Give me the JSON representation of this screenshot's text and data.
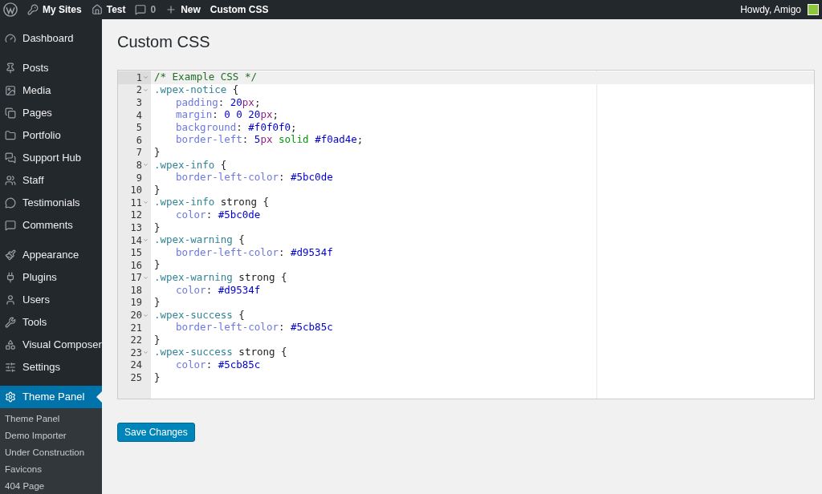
{
  "admin_bar": {
    "items": [
      {
        "label": "My Sites"
      },
      {
        "label": "Test"
      },
      {
        "label": "0"
      },
      {
        "label": "New"
      },
      {
        "label": "Custom CSS"
      }
    ],
    "greeting": "Howdy, Amigo"
  },
  "sidebar": {
    "groups": [
      [
        {
          "label": "Dashboard",
          "selected": false
        }
      ],
      [
        {
          "label": "Posts",
          "selected": false
        },
        {
          "label": "Media",
          "selected": false
        },
        {
          "label": "Pages",
          "selected": false
        },
        {
          "label": "Portfolio",
          "selected": false
        },
        {
          "label": "Support Hub",
          "selected": false
        },
        {
          "label": "Staff",
          "selected": false
        },
        {
          "label": "Testimonials",
          "selected": false
        },
        {
          "label": "Comments",
          "selected": false
        }
      ],
      [
        {
          "label": "Appearance",
          "selected": false
        },
        {
          "label": "Plugins",
          "selected": false
        },
        {
          "label": "Users",
          "selected": false
        },
        {
          "label": "Tools",
          "selected": false
        },
        {
          "label": "Visual Composer",
          "selected": false
        },
        {
          "label": "Settings",
          "selected": false
        }
      ],
      [
        {
          "label": "Theme Panel",
          "selected": true
        }
      ]
    ],
    "submenu": [
      {
        "label": "Theme Panel"
      },
      {
        "label": "Demo Importer"
      },
      {
        "label": "Under Construction"
      },
      {
        "label": "Favicons"
      },
      {
        "label": "404 Page"
      }
    ]
  },
  "page_title": "Custom CSS",
  "editor": {
    "lines": [
      {
        "number": "1",
        "foldable": true,
        "active": true,
        "indented": false,
        "tokens": [
          {
            "kind": "comment",
            "text": "/* Example CSS */"
          }
        ]
      },
      {
        "number": "2",
        "foldable": true,
        "active": false,
        "indented": false,
        "tokens": [
          {
            "kind": "selector",
            "text": ".wpex-notice"
          },
          {
            "kind": "punct",
            "text": " {"
          }
        ]
      },
      {
        "number": "3",
        "foldable": false,
        "active": false,
        "indented": true,
        "tokens": [
          {
            "kind": "property",
            "text": "padding"
          },
          {
            "kind": "punct",
            "text": ": "
          },
          {
            "kind": "number",
            "text": "20"
          },
          {
            "kind": "unit",
            "text": "px"
          },
          {
            "kind": "punct",
            "text": ";"
          }
        ]
      },
      {
        "number": "4",
        "foldable": false,
        "active": false,
        "indented": true,
        "tokens": [
          {
            "kind": "property",
            "text": "margin"
          },
          {
            "kind": "punct",
            "text": ": "
          },
          {
            "kind": "number",
            "text": "0 0 20"
          },
          {
            "kind": "unit",
            "text": "px"
          },
          {
            "kind": "punct",
            "text": ";"
          }
        ]
      },
      {
        "number": "5",
        "foldable": false,
        "active": false,
        "indented": true,
        "tokens": [
          {
            "kind": "property",
            "text": "background"
          },
          {
            "kind": "punct",
            "text": ": "
          },
          {
            "kind": "number",
            "text": "#f0f0f0"
          },
          {
            "kind": "punct",
            "text": ";"
          }
        ]
      },
      {
        "number": "6",
        "foldable": false,
        "active": false,
        "indented": true,
        "tokens": [
          {
            "kind": "property",
            "text": "border-left"
          },
          {
            "kind": "punct",
            "text": ": "
          },
          {
            "kind": "number",
            "text": "5"
          },
          {
            "kind": "unit",
            "text": "px"
          },
          {
            "kind": "constant",
            "text": " solid"
          },
          {
            "kind": "number",
            "text": " #f0ad4e"
          },
          {
            "kind": "punct",
            "text": ";"
          }
        ]
      },
      {
        "number": "7",
        "foldable": false,
        "active": false,
        "indented": false,
        "tokens": [
          {
            "kind": "punct",
            "text": "}"
          }
        ]
      },
      {
        "number": "8",
        "foldable": true,
        "active": false,
        "indented": false,
        "tokens": [
          {
            "kind": "selector",
            "text": ".wpex-info"
          },
          {
            "kind": "punct",
            "text": " {"
          }
        ]
      },
      {
        "number": "9",
        "foldable": false,
        "active": false,
        "indented": true,
        "tokens": [
          {
            "kind": "property",
            "text": "border-left-color"
          },
          {
            "kind": "punct",
            "text": ": "
          },
          {
            "kind": "number",
            "text": "#5bc0de"
          }
        ]
      },
      {
        "number": "10",
        "foldable": false,
        "active": false,
        "indented": false,
        "tokens": [
          {
            "kind": "punct",
            "text": "}"
          }
        ]
      },
      {
        "number": "11",
        "foldable": true,
        "active": false,
        "indented": false,
        "tokens": [
          {
            "kind": "selector",
            "text": ".wpex-info"
          },
          {
            "kind": "punct",
            "text": " strong {"
          }
        ]
      },
      {
        "number": "12",
        "foldable": false,
        "active": false,
        "indented": true,
        "tokens": [
          {
            "kind": "property",
            "text": "color"
          },
          {
            "kind": "punct",
            "text": ": "
          },
          {
            "kind": "number",
            "text": "#5bc0de"
          }
        ]
      },
      {
        "number": "13",
        "foldable": false,
        "active": false,
        "indented": false,
        "tokens": [
          {
            "kind": "punct",
            "text": "}"
          }
        ]
      },
      {
        "number": "14",
        "foldable": true,
        "active": false,
        "indented": false,
        "tokens": [
          {
            "kind": "selector",
            "text": ".wpex-warning"
          },
          {
            "kind": "punct",
            "text": " {"
          }
        ]
      },
      {
        "number": "15",
        "foldable": false,
        "active": false,
        "indented": true,
        "tokens": [
          {
            "kind": "property",
            "text": "border-left-color"
          },
          {
            "kind": "punct",
            "text": ": "
          },
          {
            "kind": "number",
            "text": "#d9534f"
          }
        ]
      },
      {
        "number": "16",
        "foldable": false,
        "active": false,
        "indented": false,
        "tokens": [
          {
            "kind": "punct",
            "text": "}"
          }
        ]
      },
      {
        "number": "17",
        "foldable": true,
        "active": false,
        "indented": false,
        "tokens": [
          {
            "kind": "selector",
            "text": ".wpex-warning"
          },
          {
            "kind": "punct",
            "text": " strong {"
          }
        ]
      },
      {
        "number": "18",
        "foldable": false,
        "active": false,
        "indented": true,
        "tokens": [
          {
            "kind": "property",
            "text": "color"
          },
          {
            "kind": "punct",
            "text": ": "
          },
          {
            "kind": "number",
            "text": "#d9534f"
          }
        ]
      },
      {
        "number": "19",
        "foldable": false,
        "active": false,
        "indented": false,
        "tokens": [
          {
            "kind": "punct",
            "text": "}"
          }
        ]
      },
      {
        "number": "20",
        "foldable": true,
        "active": false,
        "indented": false,
        "tokens": [
          {
            "kind": "selector",
            "text": ".wpex-success"
          },
          {
            "kind": "punct",
            "text": " {"
          }
        ]
      },
      {
        "number": "21",
        "foldable": false,
        "active": false,
        "indented": true,
        "tokens": [
          {
            "kind": "property",
            "text": "border-left-color"
          },
          {
            "kind": "punct",
            "text": ": "
          },
          {
            "kind": "number",
            "text": "#5cb85c"
          }
        ]
      },
      {
        "number": "22",
        "foldable": false,
        "active": false,
        "indented": false,
        "tokens": [
          {
            "kind": "punct",
            "text": "}"
          }
        ]
      },
      {
        "number": "23",
        "foldable": true,
        "active": false,
        "indented": false,
        "tokens": [
          {
            "kind": "selector",
            "text": ".wpex-success"
          },
          {
            "kind": "punct",
            "text": " strong {"
          }
        ]
      },
      {
        "number": "24",
        "foldable": false,
        "active": false,
        "indented": true,
        "tokens": [
          {
            "kind": "property",
            "text": "color"
          },
          {
            "kind": "punct",
            "text": ": "
          },
          {
            "kind": "number",
            "text": "#5cb85c"
          }
        ]
      },
      {
        "number": "25",
        "foldable": false,
        "active": false,
        "indented": false,
        "tokens": [
          {
            "kind": "punct",
            "text": "}"
          }
        ]
      }
    ]
  },
  "save_button": "Save Changes"
}
